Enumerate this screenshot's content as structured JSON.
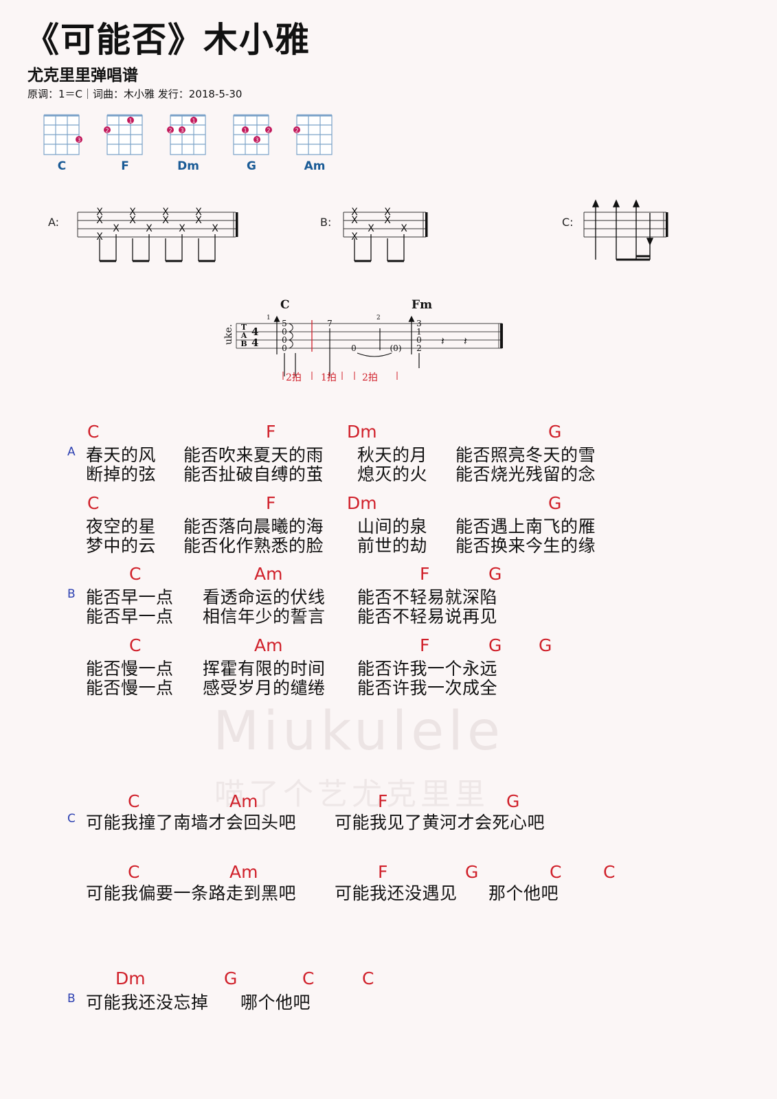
{
  "header": {
    "title": "《可能否》木小雅",
    "subtitle": "尤克里里弹唱谱",
    "meta": "原调：1＝C｜词曲：木小雅   发行：2018-5-30"
  },
  "chord_diagrams": [
    {
      "name": "C",
      "fingers": [
        {
          "string": 4,
          "fret": 3,
          "finger": "3"
        }
      ]
    },
    {
      "name": "F",
      "fingers": [
        {
          "string": 1,
          "fret": 2,
          "finger": "2"
        },
        {
          "string": 3,
          "fret": 1,
          "finger": "1"
        }
      ]
    },
    {
      "name": "Dm",
      "fingers": [
        {
          "string": 1,
          "fret": 2,
          "finger": "2"
        },
        {
          "string": 2,
          "fret": 2,
          "finger": "3"
        },
        {
          "string": 3,
          "fret": 1,
          "finger": "1"
        }
      ]
    },
    {
      "name": "G",
      "fingers": [
        {
          "string": 2,
          "fret": 2,
          "finger": "1"
        },
        {
          "string": 3,
          "fret": 3,
          "finger": "3"
        },
        {
          "string": 4,
          "fret": 2,
          "finger": "2"
        }
      ]
    },
    {
      "name": "Am",
      "fingers": [
        {
          "string": 1,
          "fret": 2,
          "finger": "2"
        }
      ]
    }
  ],
  "rhythms": {
    "a_label": "A:",
    "b_label": "B:",
    "c_label": "C:"
  },
  "intro_tab": {
    "instrument": "uke.",
    "time_sig": "4/4",
    "chord1": "C",
    "chord2": "Fm",
    "measure1": "1",
    "measure2": "2",
    "col1": [
      "5",
      "0",
      "0",
      "0"
    ],
    "col2": [
      "3",
      "1",
      "0",
      "2"
    ],
    "note_7": "7",
    "note_0": "0",
    "note_paren0": "(0)",
    "beat1": "2拍",
    "beat2": "1拍",
    "beat3": "2拍"
  },
  "sections": {
    "a": "A",
    "b": "B",
    "c": "C",
    "b2": "B"
  },
  "lyrics": {
    "a1_chords": [
      "C",
      "F",
      "Dm",
      "G"
    ],
    "a1_l1": [
      "春天的风",
      "能否吹来夏天的雨",
      "秋天的月",
      "能否照亮冬天的雪"
    ],
    "a1_l2": [
      "断掉的弦",
      "能否扯破自缚的茧",
      "熄灭的火",
      "能否烧光残留的念"
    ],
    "a2_chords": [
      "C",
      "F",
      "Dm",
      "G"
    ],
    "a2_l1": [
      "夜空的星",
      "能否落向晨曦的海",
      "山间的泉",
      "能否遇上南飞的雁"
    ],
    "a2_l2": [
      "梦中的云",
      "能否化作熟悉的脸",
      "前世的劫",
      "能否换来今生的缘"
    ],
    "b1_chords": [
      "C",
      "Am",
      "F",
      "G"
    ],
    "b1_l1": [
      "能否早一点",
      "看透命运的伏线",
      "能否不轻易就深陷"
    ],
    "b1_l2": [
      "能否早一点",
      "相信年少的誓言",
      "能否不轻易说再见"
    ],
    "b2_chords": [
      "C",
      "Am",
      "F",
      "G",
      "G"
    ],
    "b2_l1": [
      "能否慢一点",
      "挥霍有限的时间",
      "能否许我一个永远"
    ],
    "b2_l2": [
      "能否慢一点",
      "感受岁月的缱绻",
      "能否许我一次成全"
    ],
    "c1_chords": [
      "C",
      "Am",
      "F",
      "G"
    ],
    "c1_l1": [
      "可能我撞了南墙才会回头吧",
      "可能我见了黄河才会死心吧"
    ],
    "c2_chords": [
      "C",
      "Am",
      "F",
      "G",
      "C",
      "C"
    ],
    "c2_l1": [
      "可能我偏要一条路走到黑吧",
      "可能我还没遇见",
      "那个他吧"
    ],
    "d1_chords": [
      "Dm",
      "G",
      "C",
      "C"
    ],
    "d1_l1": [
      "可能我还没忘掉",
      "哪个他吧"
    ]
  },
  "watermark": {
    "brand": "Miukulele",
    "sub": "喵了个艺尤克里里"
  }
}
